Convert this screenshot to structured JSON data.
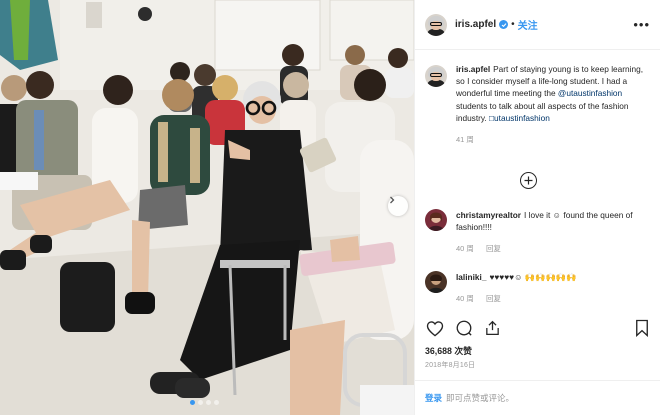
{
  "header": {
    "username": "iris.apfel",
    "separator": "•",
    "follow_label": "关注",
    "more_label": "•••",
    "verified_icon": "verified-badge-icon",
    "more_icon": "more-options-icon"
  },
  "caption": {
    "username": "iris.apfel",
    "text_1": "Part of staying young is to keep learning, so I consider myself a life-long student. I had a wonderful time meeting the ",
    "mention": "@utaustinfashion",
    "text_2": " students to talk about all aspects of the fashion industry. ",
    "hashtag": "□utaustinfashion",
    "age": "41 周"
  },
  "load_more_icon": "plus-circle-icon",
  "comments": [
    {
      "username": "christamyrealtor",
      "text": "I love it ☺ found the queen of fashion!!!!",
      "age": "40 周",
      "reply_label": "回复",
      "avatar_color": "#7a2d3a"
    },
    {
      "username": "laliniki_",
      "text": "♥♥♥♥♥☺ 🙌🙌🙌🙌🙌",
      "age": "40 周",
      "reply_label": "回复",
      "avatar_color": "#4a3326"
    }
  ],
  "actions": {
    "like_icon": "heart-icon",
    "comment_icon": "comment-icon",
    "share_icon": "share-icon",
    "save_icon": "bookmark-icon"
  },
  "likes": "36,688 次赞",
  "date": "2018年8月16日",
  "footer": {
    "login_label": "登录",
    "prompt": "即可点赞或评论。"
  },
  "carousel": {
    "dot_count": 4,
    "active_index": 0,
    "next_icon": "chevron-right-icon"
  },
  "colors": {
    "link_blue": "#3897f0",
    "mention_dark_blue": "#003569",
    "muted_gray": "#999999"
  }
}
